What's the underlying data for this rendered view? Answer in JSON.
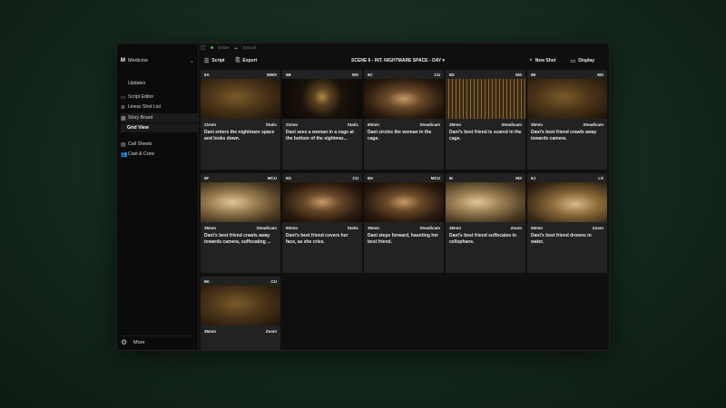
{
  "sidebar": {
    "workspace_badge": "M",
    "workspace_name": "Medicine",
    "items": [
      {
        "label": "Updates"
      },
      {
        "label": "Script Editor"
      },
      {
        "label": "Linear Shot List"
      },
      {
        "label": "Story Board"
      },
      {
        "label": "Grid View"
      },
      {
        "label": "Call Sheets"
      },
      {
        "label": "Cast & Crew"
      }
    ],
    "more_label": "More"
  },
  "status": {
    "online": "Online",
    "synced": "Synced"
  },
  "toolbar": {
    "script_label": "Script",
    "export_label": "Export",
    "scene_title": "SCENE 6 - INT. NIGHTMARE SPACE - DAY",
    "new_shot_label": "New Shot",
    "display_label": "Display"
  },
  "shots": [
    {
      "id": "6A",
      "type": "MWS",
      "lens": "21mm",
      "move": "Static",
      "desc": "Dani enters the nightmare space and looks down.",
      "tone": "warm"
    },
    {
      "id": "6B",
      "type": "WS",
      "lens": "21mm",
      "move": "Static",
      "desc": "Dani sees a woman in a cage at the bottom of the nightmar...",
      "tone": "dark"
    },
    {
      "id": "6C",
      "type": "CU",
      "lens": "50mm",
      "move": "Steadicam",
      "desc": "Dani circles the woman in the cage.",
      "tone": "face"
    },
    {
      "id": "6D",
      "type": "MS",
      "lens": "35mm",
      "move": "Steadicam",
      "desc": "Dani's best friend is scared in the cage.",
      "tone": "cage"
    },
    {
      "id": "6E",
      "type": "MS",
      "lens": "35mm",
      "move": "Steadicam",
      "desc": "Dani's best friend crawls away towards camera.",
      "tone": "warm"
    },
    {
      "id": "6F",
      "type": "MCU",
      "lens": "35mm",
      "move": "Steadicam",
      "desc": "Dani's best friend crawls away towards camera, suffocating ...",
      "tone": "plastic"
    },
    {
      "id": "6G",
      "type": "CU",
      "lens": "50mm",
      "move": "Static",
      "desc": "Dani's best friend covers her face, as she cries.",
      "tone": "face"
    },
    {
      "id": "6H",
      "type": "MCU",
      "lens": "35mm",
      "move": "Steadicam",
      "desc": "Dani steps forward, haunting her best friend.",
      "tone": "face"
    },
    {
      "id": "6I",
      "type": "MS",
      "lens": "35mm",
      "move": "Zoom",
      "desc": "Dani's best friend suffocates in cellophane.",
      "tone": "plastic"
    },
    {
      "id": "6J",
      "type": "LS",
      "lens": "50mm",
      "move": "Zoom",
      "desc": "Dani's best friend drowns in water.",
      "tone": "water"
    },
    {
      "id": "6K",
      "type": "CU",
      "lens": "35mm",
      "move": "Zoom",
      "desc": "",
      "tone": "warm"
    }
  ]
}
